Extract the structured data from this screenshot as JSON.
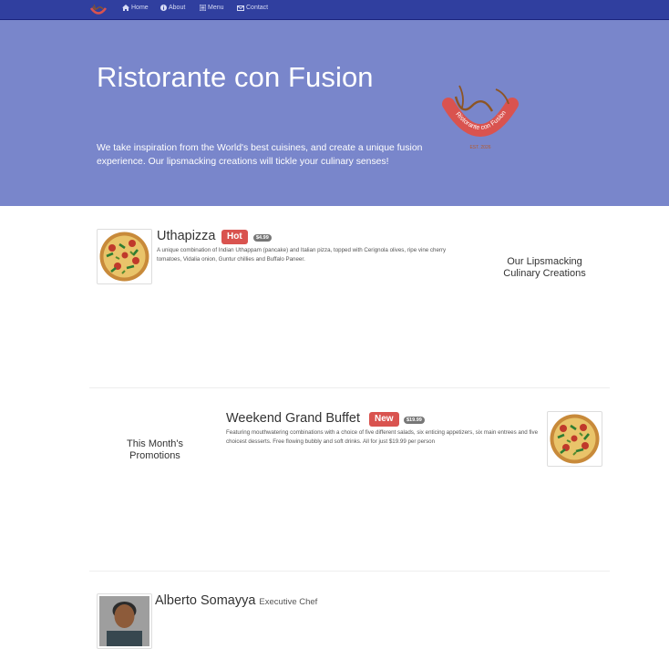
{
  "nav": {
    "items": [
      {
        "label": "Home",
        "icon": "home-icon"
      },
      {
        "label": "About",
        "icon": "info-icon"
      },
      {
        "label": "Menu",
        "icon": "list-icon"
      },
      {
        "label": "Contact",
        "icon": "envelope-icon"
      }
    ]
  },
  "jumbotron": {
    "title": "Ristorante con Fusion",
    "tagline": "We take inspiration from the World's best cuisines, and create a unique fusion experience. Our lipsmacking creations will tickle your culinary senses!",
    "logo_text": "Ristorante con Fusion",
    "logo_est": "EST. 2026"
  },
  "dish": {
    "name": "Uthapizza",
    "label": "Hot",
    "price": "$4.99",
    "description": "A unique combination of Indian Uthappam (pancake) and Italian pizza, topped with Cerignola olives, ripe vine cherry tomatoes, Vidalia onion, Guntur chillies and Buffalo Paneer.",
    "section_heading": "Our Lipsmacking Culinary Creations"
  },
  "promotion": {
    "name": "Weekend Grand Buffet",
    "label": "New",
    "price": "$19.99",
    "description": "Featuring mouthwatering combinations with a choice of five different salads, six enticing appetizers, six main entrees and five choicest desserts. Free flowing bubbly and soft drinks. All for just $19.99 per person",
    "section_heading": "This Month's Promotions"
  },
  "leader": {
    "name": "Alberto Somayya",
    "designation": "Executive Chef"
  },
  "colors": {
    "navbar": "#303f9f",
    "jumbotron": "#7986cb",
    "label_danger": "#d9534f",
    "badge": "#777777"
  }
}
